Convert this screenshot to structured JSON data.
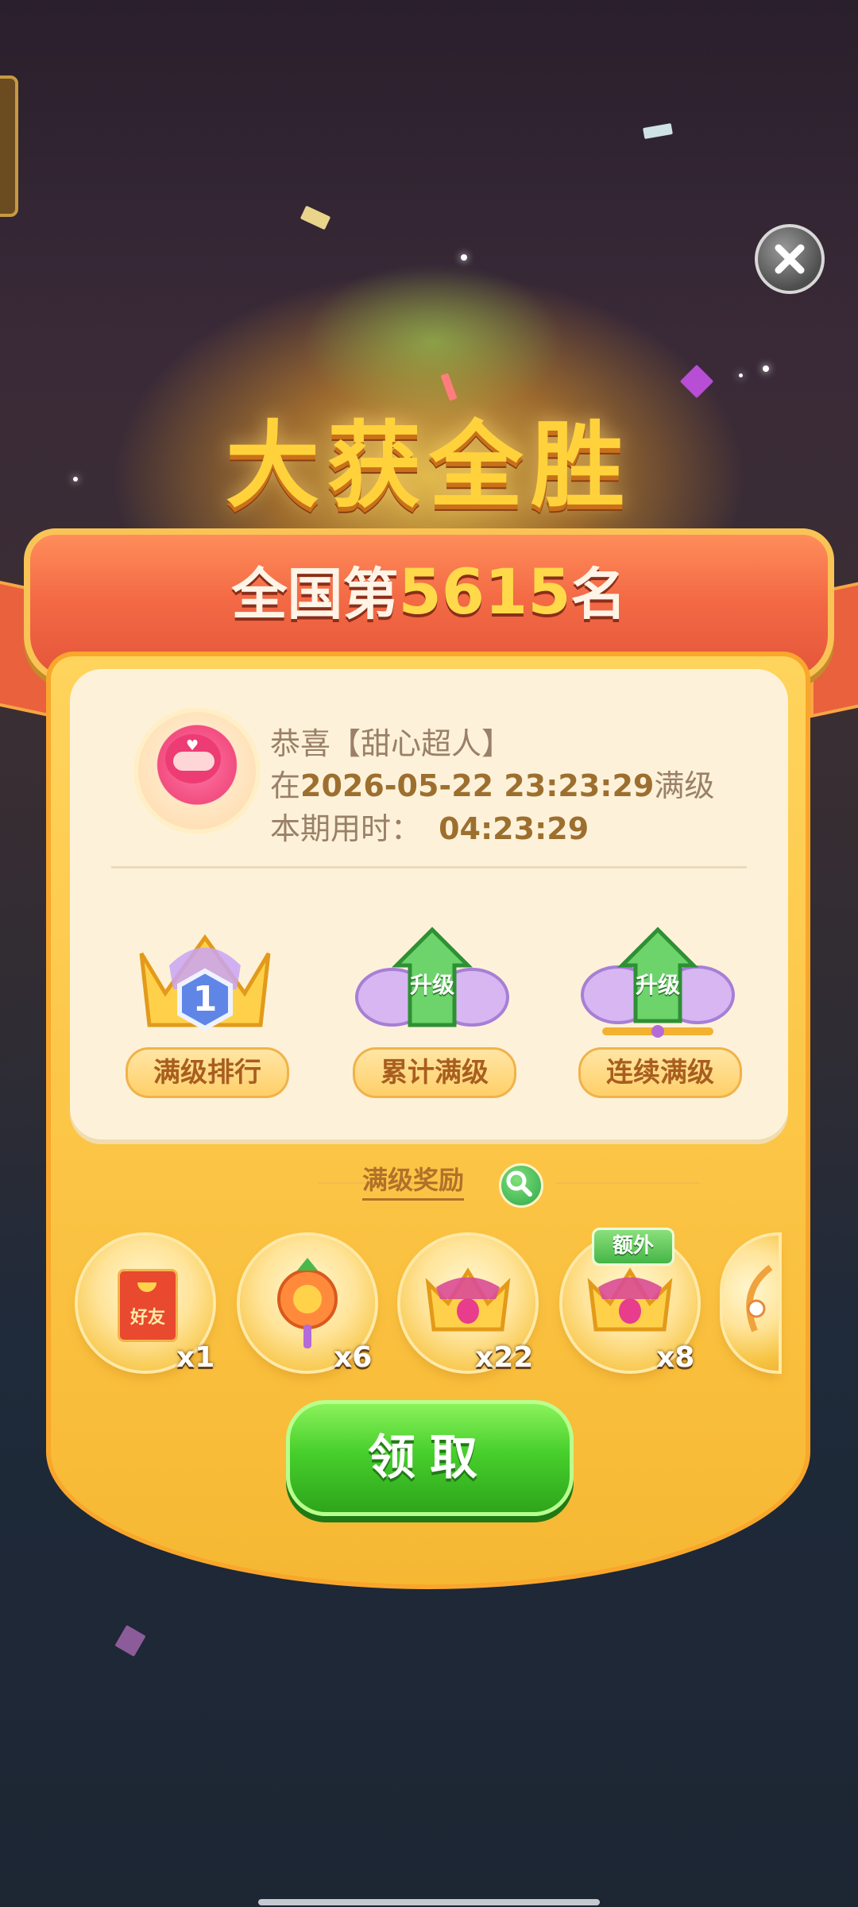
{
  "header": {
    "title": "大获全胜"
  },
  "ribbon": {
    "prefix": "全国第",
    "rank": "5615",
    "suffix": "名"
  },
  "info": {
    "line1": "恭喜【甜心超人】",
    "line2_prefix": "在",
    "line2_time": "2026-05-22 23:23:29",
    "line2_suffix": "满级",
    "line3_label": "本期用时：",
    "line3_value": "04:23:29"
  },
  "features": [
    {
      "label": "满级排行",
      "badge": "1",
      "icon": "crown-rank-icon"
    },
    {
      "label": "累计满级",
      "badge": "升级",
      "icon": "wing-arrow-icon"
    },
    {
      "label": "连续满级",
      "badge": "升级",
      "icon": "wing-arrow-crown-icon"
    }
  ],
  "rewards": {
    "title": "满级奖励",
    "items": [
      {
        "icon": "red-envelope-icon",
        "text": "好友",
        "count": "x1"
      },
      {
        "icon": "magic-wand-icon",
        "count": "x6"
      },
      {
        "icon": "crown-icon",
        "count": "x22"
      },
      {
        "icon": "crown-icon",
        "count": "x8",
        "extra": "额外"
      },
      {
        "icon": "partial-item-icon"
      }
    ]
  },
  "claim": {
    "label": "领取"
  },
  "colors": {
    "accent": "#ffd23c",
    "ribbon": "#f36a45",
    "panel": "#fbc343",
    "button": "#47cf2c"
  }
}
